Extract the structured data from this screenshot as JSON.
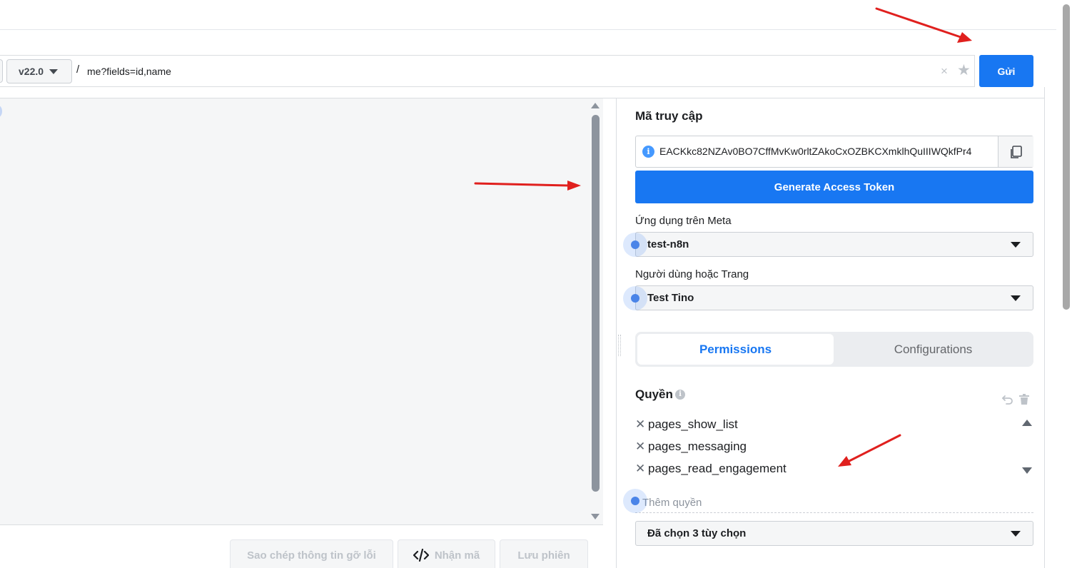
{
  "query": {
    "version": "v22.0",
    "separator": "/",
    "path": "me?fields=id,name",
    "clear_symbol": "×",
    "star_symbol": "★",
    "submit_label": "Gửi"
  },
  "access_token": {
    "title": "Mã truy cập",
    "info_symbol": "i",
    "value": "EACKkc82NZAv0BO7CffMvKw0rltZAkoCxOZBKCXmklhQuIIIWQkfPr4",
    "generate_label": "Generate Access Token"
  },
  "meta_app": {
    "label": "Ứng dụng trên Meta",
    "selected": "test-n8n"
  },
  "user_or_page": {
    "label": "Người dùng hoặc Trang",
    "selected": "Test Tino"
  },
  "tabs": {
    "permissions": "Permissions",
    "configurations": "Configurations",
    "active": "Permissions"
  },
  "permissions": {
    "title": "Quyền",
    "info_symbol": "i",
    "remove_symbol": "✕",
    "items": [
      "pages_show_list",
      "pages_messaging",
      "pages_read_engagement"
    ],
    "add_placeholder": "Thêm quyền",
    "selection_summary": "Đã chọn 3 tùy chọn"
  },
  "footer": {
    "copy_debug_label": "Sao chép thông tin gỡ lỗi",
    "get_code_label": "Nhận mã",
    "get_code_icon": "code-icon",
    "save_session_label": "Lưu phiên"
  },
  "colors": {
    "primary": "#1877f2",
    "annotation_arrow": "#e0201e",
    "panel_bg": "#f5f6f7"
  }
}
